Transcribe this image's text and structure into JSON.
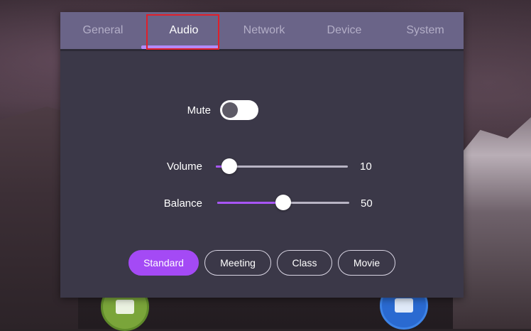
{
  "tabs": [
    {
      "label": "General"
    },
    {
      "label": "Audio"
    },
    {
      "label": "Network"
    },
    {
      "label": "Device"
    },
    {
      "label": "System"
    }
  ],
  "active_tab": "Audio",
  "mute": {
    "label": "Mute",
    "on": false
  },
  "volume": {
    "label": "Volume",
    "value": "10",
    "level": 10
  },
  "balance": {
    "label": "Balance",
    "value": "50",
    "level": 50
  },
  "presets": [
    {
      "label": "Standard",
      "selected": true
    },
    {
      "label": "Meeting",
      "selected": false
    },
    {
      "label": "Class",
      "selected": false
    },
    {
      "label": "Movie",
      "selected": false
    }
  ],
  "colors": {
    "accent": "#a855f7",
    "tab_bar": "#6a6488",
    "panel": "#3b3848",
    "highlight_box": "#e0202a"
  }
}
